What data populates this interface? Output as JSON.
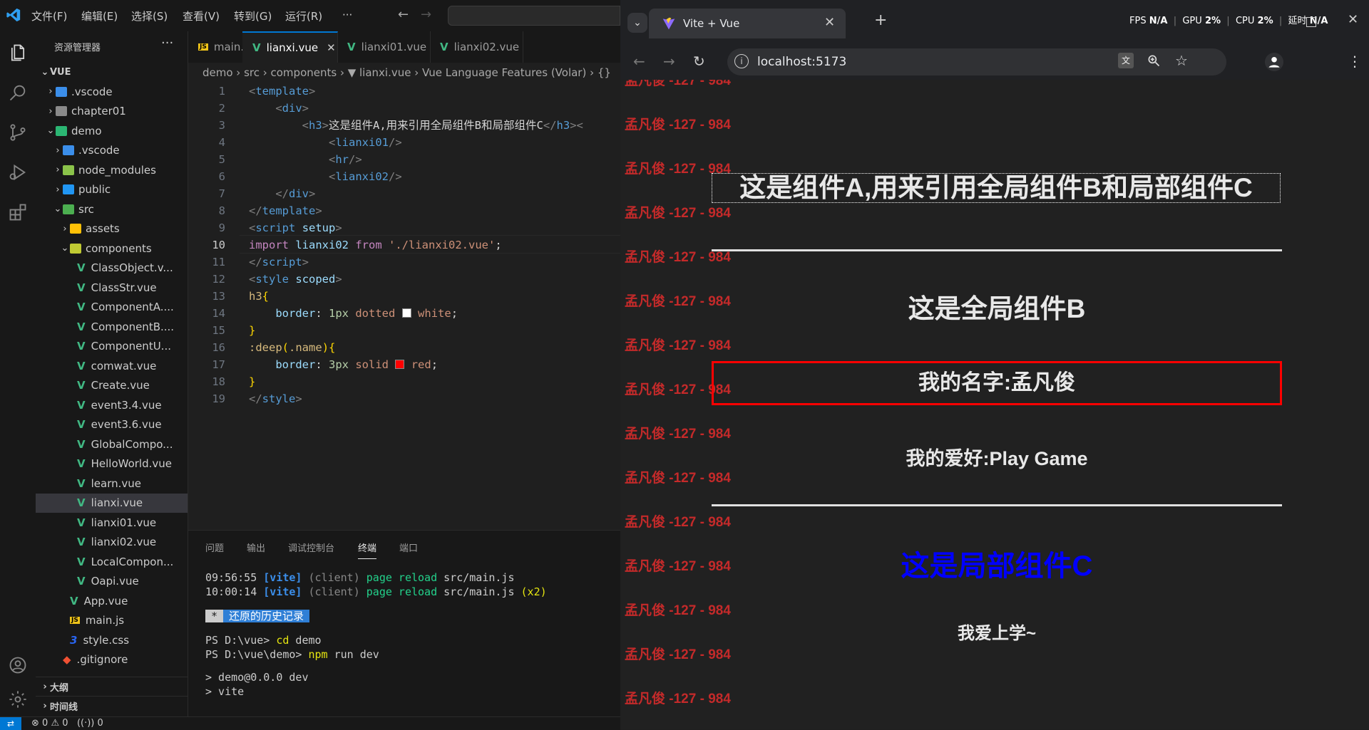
{
  "vscode": {
    "menu": [
      "文件(F)",
      "编辑(E)",
      "选择(S)",
      "查看(V)",
      "转到(G)",
      "运行(R)",
      "···"
    ],
    "explorer_title": "资源管理器",
    "root": "VUE",
    "tree": [
      {
        "label": ".vscode",
        "indent": 1,
        "chev": "›",
        "color": "#3b8eea"
      },
      {
        "label": "chapter01",
        "indent": 1,
        "chev": "›",
        "color": "#8a8a8a"
      },
      {
        "label": "demo",
        "indent": 1,
        "chev": "⌄",
        "color": "#2bb673"
      },
      {
        "label": ".vscode",
        "indent": 2,
        "chev": "›",
        "color": "#3b8eea"
      },
      {
        "label": "node_modules",
        "indent": 2,
        "chev": "›",
        "color": "#8bc34a"
      },
      {
        "label": "public",
        "indent": 2,
        "chev": "›",
        "color": "#2196f3"
      },
      {
        "label": "src",
        "indent": 2,
        "chev": "⌄",
        "color": "#4caf50"
      },
      {
        "label": "assets",
        "indent": 3,
        "chev": "›",
        "color": "#ffc107"
      },
      {
        "label": "components",
        "indent": 3,
        "chev": "⌄",
        "color": "#c0ca33"
      },
      {
        "label": "ClassObject.v...",
        "indent": 4,
        "chev": "",
        "color": "vue"
      },
      {
        "label": "ClassStr.vue",
        "indent": 4,
        "chev": "",
        "color": "vue"
      },
      {
        "label": "ComponentA....",
        "indent": 4,
        "chev": "",
        "color": "vue"
      },
      {
        "label": "ComponentB....",
        "indent": 4,
        "chev": "",
        "color": "vue"
      },
      {
        "label": "ComponentU...",
        "indent": 4,
        "chev": "",
        "color": "vue"
      },
      {
        "label": "comwat.vue",
        "indent": 4,
        "chev": "",
        "color": "vue"
      },
      {
        "label": "Create.vue",
        "indent": 4,
        "chev": "",
        "color": "vue"
      },
      {
        "label": "event3.4.vue",
        "indent": 4,
        "chev": "",
        "color": "vue"
      },
      {
        "label": "event3.6.vue",
        "indent": 4,
        "chev": "",
        "color": "vue"
      },
      {
        "label": "GlobalCompo...",
        "indent": 4,
        "chev": "",
        "color": "vue"
      },
      {
        "label": "HelloWorld.vue",
        "indent": 4,
        "chev": "",
        "color": "vue"
      },
      {
        "label": "learn.vue",
        "indent": 4,
        "chev": "",
        "color": "vue"
      },
      {
        "label": "lianxi.vue",
        "indent": 4,
        "chev": "",
        "color": "vue",
        "selected": true
      },
      {
        "label": "lianxi01.vue",
        "indent": 4,
        "chev": "",
        "color": "vue"
      },
      {
        "label": "lianxi02.vue",
        "indent": 4,
        "chev": "",
        "color": "vue"
      },
      {
        "label": "LocalCompon...",
        "indent": 4,
        "chev": "",
        "color": "vue"
      },
      {
        "label": "Oapi.vue",
        "indent": 4,
        "chev": "",
        "color": "vue"
      },
      {
        "label": "App.vue",
        "indent": 3,
        "chev": "",
        "color": "vue"
      },
      {
        "label": "main.js",
        "indent": 3,
        "chev": "",
        "color": "js"
      },
      {
        "label": "style.css",
        "indent": 3,
        "chev": "",
        "color": "css"
      },
      {
        "label": ".gitignore",
        "indent": 2,
        "chev": "",
        "color": "git"
      }
    ],
    "outline": "大纲",
    "timeline": "时间线",
    "tabs": [
      {
        "label": "main.js",
        "icon": "JS"
      },
      {
        "label": "lianxi.vue",
        "icon": "V",
        "active": true
      },
      {
        "label": "lianxi01.vue",
        "icon": "V"
      },
      {
        "label": "lianxi02.vue",
        "icon": "V"
      }
    ],
    "breadcrumb": "demo › src › components › ▼ lianxi.vue › Vue Language Features (Volar) › {}",
    "code_lines": [
      "1",
      "2",
      "3",
      "4",
      "5",
      "6",
      "7",
      "8",
      "9",
      "10",
      "11",
      "12",
      "13",
      "14",
      "15",
      "16",
      "17",
      "18",
      "19"
    ],
    "panel_tabs": [
      "问题",
      "输出",
      "调试控制台",
      "终端",
      "端口"
    ],
    "terminal": {
      "line1_time": "09:56:55",
      "line1_tag": "[vite]",
      "line1_client": "(client)",
      "line1_msg": "page reload",
      "line1_file": "src/main.js",
      "line2_time": "10:00:14",
      "line2_tag": "[vite]",
      "line2_client": "(client)",
      "line2_msg": "page reload",
      "line2_file": "src/main.js",
      "line2_extra": "(x2)",
      "history_star": "*",
      "history": "还原的历史记录",
      "ps1": "PS D:\\vue> ",
      "cmd1": "cd",
      "cmd1_arg": " demo",
      "ps2": "PS D:\\vue\\demo> ",
      "cmd2": "npm",
      "cmd2_arg": " run dev",
      "out1": "> demo@0.0.0 dev",
      "out2": "> vite"
    },
    "status": {
      "errors": "0",
      "warnings": "0",
      "ports": "0"
    }
  },
  "browser": {
    "tab_title": "Vite + Vue",
    "url": "localhost:5173",
    "perf": {
      "fps_label": "FPS",
      "fps": "N/A",
      "gpu_label": "GPU",
      "gpu": "2%",
      "cpu_label": "CPU",
      "cpu": "2%",
      "delay_label": "延时",
      "delay": "N/A"
    },
    "watermark": "孟凡俊 -127 - 984",
    "page": {
      "title_a": "这是组件A,用来引用全局组件B和局部组件C",
      "title_b": "这是全局组件B",
      "name": "我的名字:孟凡俊",
      "hobby": "我的爱好:Play Game",
      "title_c": "这是局部组件C",
      "c_text": "我爱上学~"
    },
    "colors": {
      "local_c": "#0000ff",
      "border_red": "#ff0000",
      "watermark": "#c42a2a"
    }
  }
}
